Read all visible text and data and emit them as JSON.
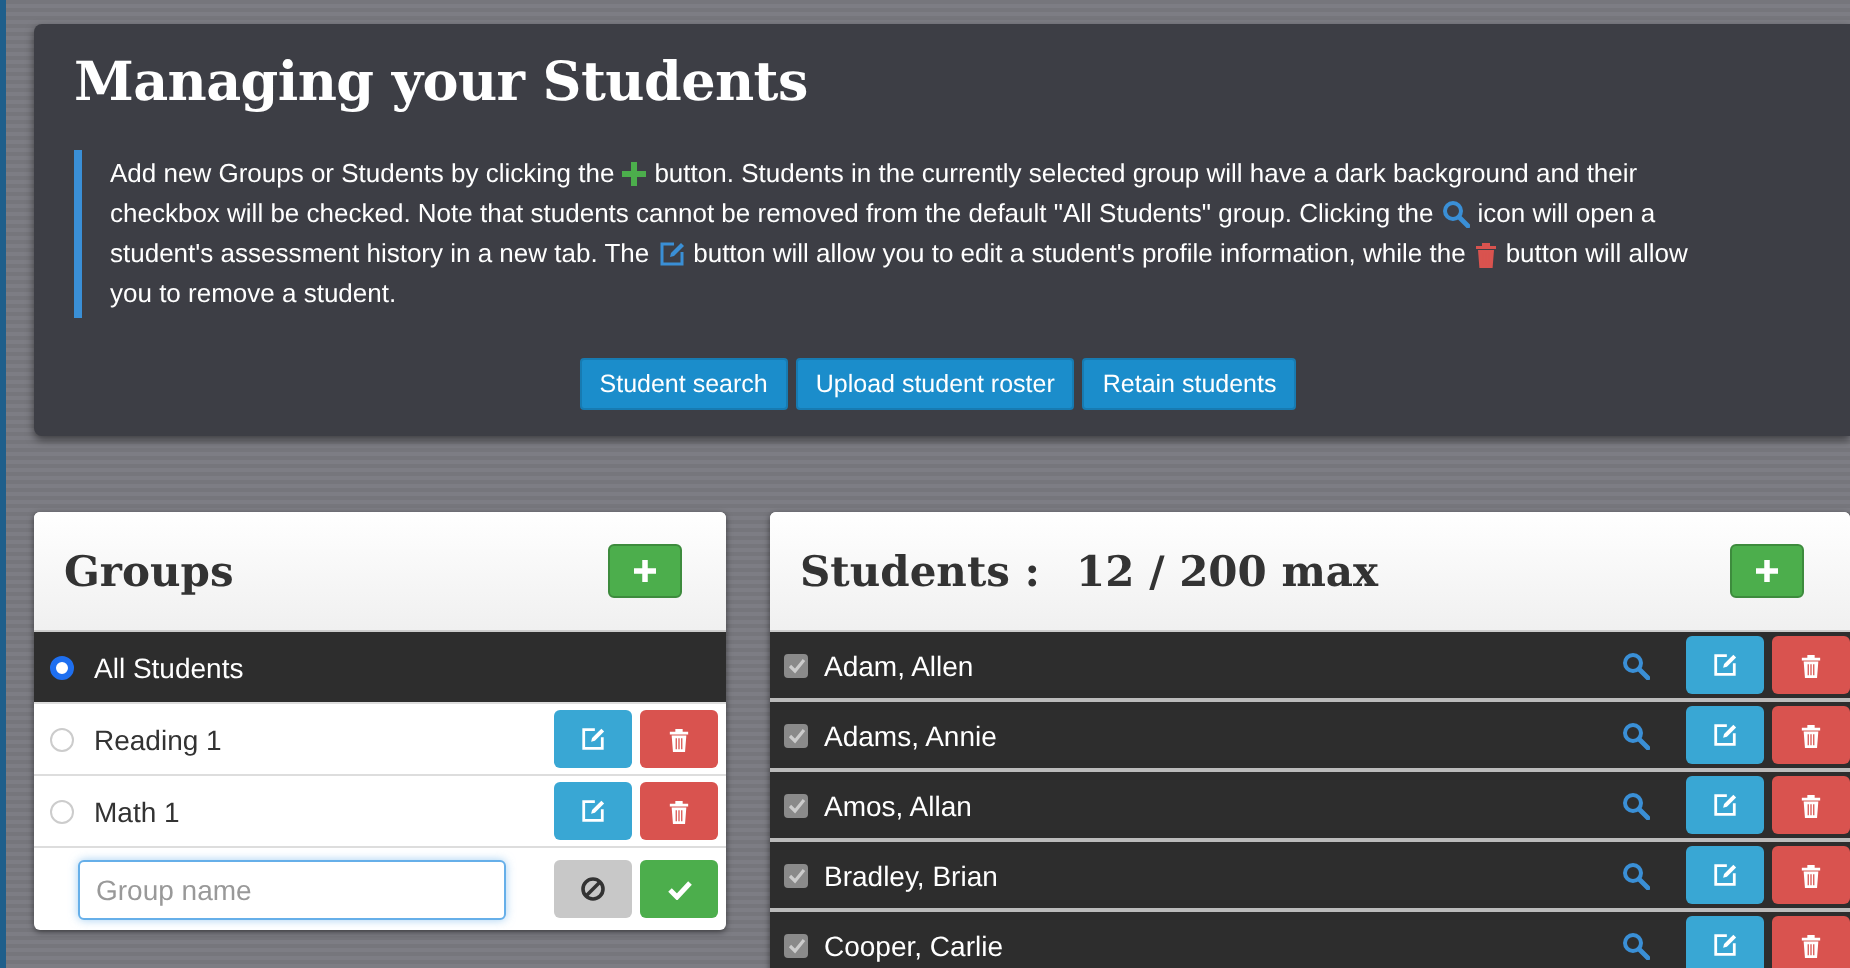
{
  "intro": {
    "title": "Managing your Students",
    "paragraph": [
      [
        {
          "kind": "text",
          "text": "Add new Groups or Students by clicking the"
        },
        {
          "kind": "plus"
        },
        {
          "kind": "text",
          "text": "button. Students in the currently selected group will have a dark background and their"
        }
      ],
      [
        {
          "kind": "text",
          "text": "checkbox will be checked. Note that students cannot be removed from the default \"All Students\" group. Clicking the"
        },
        {
          "kind": "search"
        },
        {
          "kind": "text",
          "text": "icon will open a"
        }
      ],
      [
        {
          "kind": "text",
          "text": "student's assessment history in a new tab. The"
        },
        {
          "kind": "edit"
        },
        {
          "kind": "text",
          "text": "button will allow you to edit a student's profile information, while the"
        },
        {
          "kind": "trash"
        },
        {
          "kind": "text",
          "text": "button will allow"
        }
      ],
      [
        {
          "kind": "text",
          "text": "you to remove a student."
        }
      ]
    ],
    "buttons": [
      "Student search",
      "Upload student roster",
      "Retain students"
    ]
  },
  "groups": {
    "title": "Groups",
    "items": [
      {
        "name": "All Students",
        "selected": true,
        "editable": false
      },
      {
        "name": "Reading 1",
        "selected": false,
        "editable": true
      },
      {
        "name": "Math 1",
        "selected": false,
        "editable": true
      }
    ],
    "new_group": {
      "placeholder": "Group name"
    }
  },
  "students": {
    "title": "Students :",
    "count": "12 / 200 max",
    "items": [
      {
        "name": "Adam, Allen",
        "checked": true
      },
      {
        "name": "Adams, Annie",
        "checked": true
      },
      {
        "name": "Amos, Allan",
        "checked": true
      },
      {
        "name": "Bradley, Brian",
        "checked": true
      },
      {
        "name": "Cooper, Carlie",
        "checked": true
      }
    ]
  }
}
